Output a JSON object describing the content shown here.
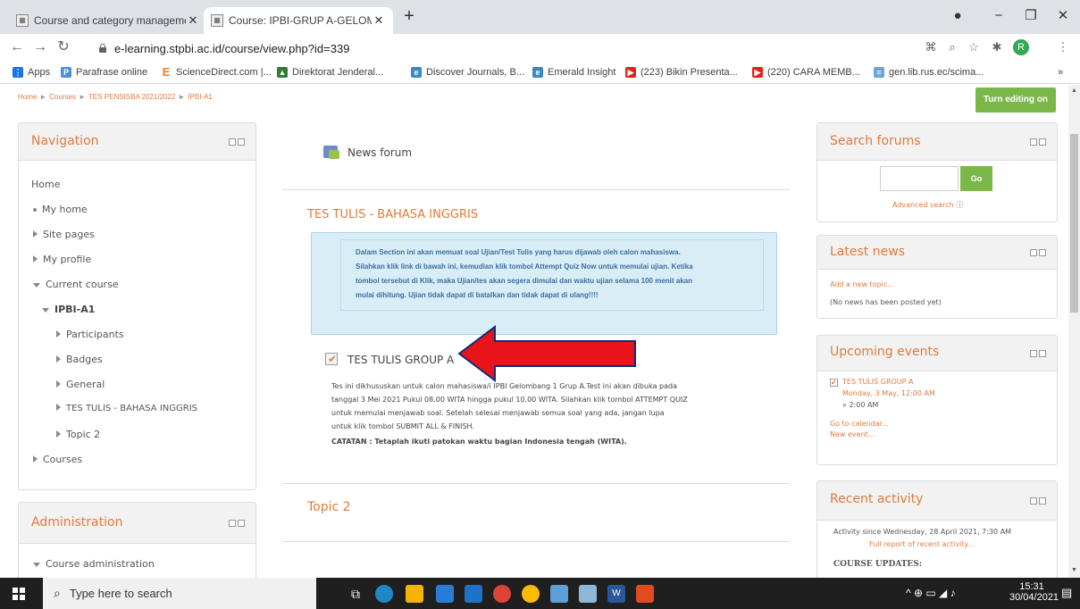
{
  "browser": {
    "tabs": [
      {
        "title": "Course and category manageme",
        "active": false
      },
      {
        "title": "Course: IPBI-GRUP A-GELOMBAN",
        "active": true
      }
    ],
    "new_tab": "+",
    "url": "e-learning.stpbi.ac.id/course/view.php?id=339",
    "avatar_letter": "R",
    "bookmarks": [
      "Apps",
      "Parafrase online",
      "ScienceDirect.com |...",
      "Direktorat Jenderal...",
      "Discover Journals, B...",
      "Emerald Insight",
      "(223) Bikin Presenta...",
      "(220) CARA MEMB...",
      "gen.lib.rus.ec/scima..."
    ],
    "bookmarks_more": "»"
  },
  "breadcrumb": [
    "Home",
    "Courses",
    "TES PENSISBA 2021/2022",
    "IPBI-A1"
  ],
  "edit_button": "Turn editing on",
  "navigation": {
    "title": "Navigation",
    "home": "Home",
    "my_home": "My home",
    "site_pages": "Site pages",
    "my_profile": "My profile",
    "current_course": "Current course",
    "course": "IPBI-A1",
    "participants": "Participants",
    "badges": "Badges",
    "general": "General",
    "tes_tulis": "TES TULIS - BAHASA INGGRIS",
    "topic2": "Topic 2",
    "courses": "Courses"
  },
  "administration": {
    "title": "Administration",
    "course_admin": "Course administration"
  },
  "main": {
    "news_forum": "News forum",
    "section1_title": "TES TULIS - BAHASA INGGRIS",
    "info_lines": [
      "Dalam Section ini akan memuat soal Ujian/Test Tulis yang harus dijawab oleh calon mahasiswa.",
      "Silahkan klik link di bawah ini, kemudian klik tombol Attempt Quiz Now untuk memulai ujian. Ketika",
      "tombol tersebut di Klik, maka Ujian/tes akan segera dimulai dan waktu ujian selama 100 menit akan",
      "mulai dihitung. Ujian tidak dapat di batalkan dan tidak dapat di ulang!!!!"
    ],
    "quiz_title": "TES TULIS GROUP A",
    "quiz_desc_lines": [
      "Tes ini dikhususkan untuk calon mahasiswa/i IPBI Gelombang 1 Grup A.Test ini akan dibuka pada",
      "tanggal 3 Mei 2021 Pukul 08.00 WITA hingga pukul 10.00 WITA. Silahkan klik tombol ATTEMPT QUIZ",
      "untuk memulai menjawab soal. Setelah selesai menjawab semua soal yang ada, jangan lupa",
      "untuk klik tombol SUBMIT ALL & FINISH."
    ],
    "catatan": "CATATAN :  Tetaplah ikuti patokan waktu bagian Indonesia tengah (WITA).",
    "topic2_title": "Topic 2"
  },
  "search_forums": {
    "title": "Search forums",
    "go": "Go",
    "advanced": "Advanced search"
  },
  "latest_news": {
    "title": "Latest news",
    "add": "Add a new topic...",
    "none": "(No news has been posted yet)"
  },
  "upcoming": {
    "title": "Upcoming events",
    "event": "TES TULIS GROUP A",
    "date": "Monday, 3 May, 12:00 AM",
    "end": "» 2:00 AM",
    "calendar": "Go to calendar...",
    "new_event": "New event..."
  },
  "recent": {
    "title": "Recent activity",
    "since": "Activity since Wednesday, 28 April 2021, 7:30 AM",
    "full": "Full report of recent activity...",
    "updates": "COURSE UPDATES:"
  },
  "taskbar": {
    "search": "Type here to search",
    "time": "15:31",
    "date": "30/04/2021"
  },
  "colors": {
    "accent": "#e07b3c",
    "green_button": "#7bb84a",
    "info_bg": "#d9edf7",
    "arrow": "#e8141a"
  }
}
